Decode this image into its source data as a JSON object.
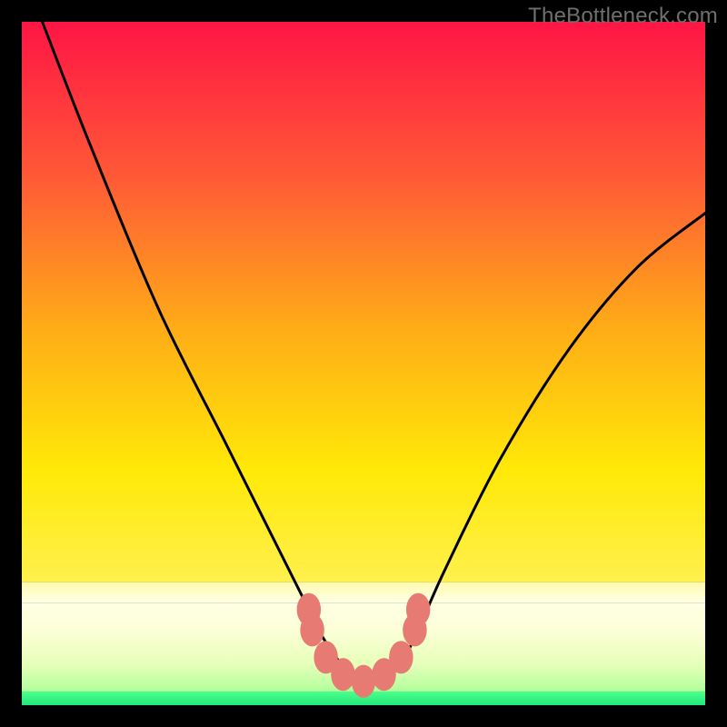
{
  "watermark": "TheBottleneck.com",
  "chart_data": {
    "type": "line",
    "title": "",
    "xlabel": "",
    "ylabel": "",
    "xlim": [
      0,
      100
    ],
    "ylim": [
      0,
      100
    ],
    "series": [
      {
        "name": "curve",
        "x": [
          3,
          10,
          20,
          30,
          38,
          42,
          44,
          46,
          48,
          50,
          52,
          54,
          56,
          58,
          62,
          70,
          80,
          90,
          100
        ],
        "y": [
          100,
          82,
          58,
          38,
          22,
          14,
          10,
          7,
          4.5,
          3.5,
          3.5,
          4.5,
          7,
          11,
          20,
          36,
          52,
          64,
          72
        ]
      }
    ],
    "markers": {
      "x": [
        42,
        42.5,
        44.5,
        47,
        50,
        53,
        55.5,
        57.5,
        58
      ],
      "y": [
        14,
        11,
        7,
        4.5,
        3.5,
        4.5,
        7,
        11,
        14
      ],
      "color": "#e77b73",
      "radius": 3.2
    },
    "gradient_layers": [
      {
        "y0": 0,
        "y1": 82,
        "stops": [
          {
            "offset": 0,
            "color": "#ff1545"
          },
          {
            "offset": 0.28,
            "color": "#ff5a36"
          },
          {
            "offset": 0.55,
            "color": "#ffad17"
          },
          {
            "offset": 0.8,
            "color": "#ffe907"
          },
          {
            "offset": 1.0,
            "color": "#fff04d"
          }
        ]
      },
      {
        "y0": 82,
        "y1": 85,
        "stops": [
          {
            "offset": 0,
            "color": "#fffbb1"
          },
          {
            "offset": 1,
            "color": "#ffffe4"
          }
        ]
      },
      {
        "y0": 85,
        "y1": 98,
        "stops": [
          {
            "offset": 0,
            "color": "#ffffe4"
          },
          {
            "offset": 0.3,
            "color": "#fdffd8"
          },
          {
            "offset": 0.7,
            "color": "#e6ffb8"
          },
          {
            "offset": 1,
            "color": "#b0ff9a"
          }
        ]
      },
      {
        "y0": 98,
        "y1": 100,
        "stops": [
          {
            "offset": 0,
            "color": "#4dff8c"
          },
          {
            "offset": 1,
            "color": "#20e879"
          }
        ]
      }
    ]
  }
}
